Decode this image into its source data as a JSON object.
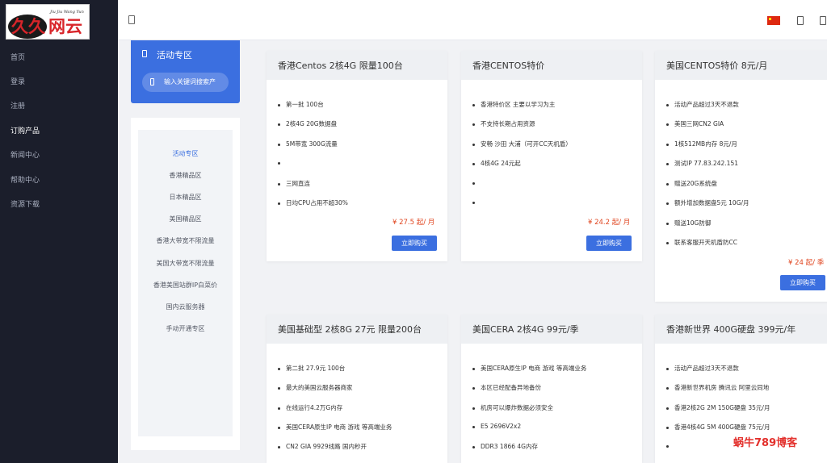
{
  "logo": {
    "text": "久久网云",
    "subtext": "Jiu Jiu Wang Yun"
  },
  "sidebar": {
    "items": [
      {
        "label": "首页"
      },
      {
        "label": "登录"
      },
      {
        "label": "注册"
      },
      {
        "label": "订购产品"
      },
      {
        "label": "新闻中心"
      },
      {
        "label": "帮助中心"
      },
      {
        "label": "资源下载"
      }
    ]
  },
  "promo": {
    "title": "活动专区",
    "search_placeholder": "输入关键词搜索产"
  },
  "categories": [
    {
      "label": "活动专区"
    },
    {
      "label": "香港精品区"
    },
    {
      "label": "日本精品区"
    },
    {
      "label": "美国精品区"
    },
    {
      "label": "香港大带宽不限流量"
    },
    {
      "label": "美国大带宽不限流量"
    },
    {
      "label": "香港美国站群IP白菜价"
    },
    {
      "label": "国内云服务器"
    },
    {
      "label": "手动开通专区"
    }
  ],
  "cards": [
    {
      "title": "香港Centos 2核4G 限量100台",
      "features": [
        "第一批  100台",
        "2核4G 20G数据盘",
        "5M带宽 300G流量",
        "",
        "三网直连",
        "日均CPU占用不超30%"
      ],
      "price": "¥ 27.5 起/ 月",
      "buy": "立即购买"
    },
    {
      "title": "香港CENTOS特价",
      "features": [
        "香港特价区 主要以学习为主",
        "不支持长期占用资源",
        "安畅  沙田  大浦（可开CC天机盾）",
        "4核4G 24元起",
        "",
        ""
      ],
      "price": "¥ 24.2 起/ 月",
      "buy": "立即购买"
    },
    {
      "title": "美国CENTOS特价 8元/月",
      "features": [
        "活动产品超过3天不退款",
        "美国三网CN2 GIA",
        "1核512MB内存 8元/月",
        "测试IP 77.83.242.151",
        "赠送20G系统盘",
        "额外增加数据盘5元 10G/月",
        "赠送10G防御",
        "联系客服开天机盾防CC"
      ],
      "price": "¥ 24 起/ 季",
      "buy": "立即购买"
    },
    {
      "title": "美国基础型 2核8G 27元 限量200台",
      "features": [
        "第二批 27.9元  100台",
        "最大的美国云服务器商家",
        "在线运行4.2万G内存",
        "美国CERA原生IP 电商 游戏 等高端业务",
        "CN2 GIA 9929线路 国内秒开"
      ]
    },
    {
      "title": "美国CERA 2核4G 99元/季",
      "features": [
        "美国CERA原生IP 电商 游戏 等高端业务",
        "本区已经配备异地备份",
        "机房可以爆炸数据必须安全",
        "E5 2696V2x2",
        "DDR3 1866  4G内存"
      ]
    },
    {
      "title": "香港新世界 400G硬盘 399元/年",
      "features": [
        "活动产品超过3天不退款",
        "香港新世界机房 腾讯云 阿里云同地",
        "香港2核2G 2M  150G硬盘 35元/月",
        "香港4核4G  5M  400G硬盘 75元/月",
        ""
      ]
    }
  ],
  "watermark": "蜗牛789博客",
  "colors": {
    "accent": "#3b6fe0",
    "sidebar": "#1b1e2b",
    "price": "#e0451f"
  }
}
